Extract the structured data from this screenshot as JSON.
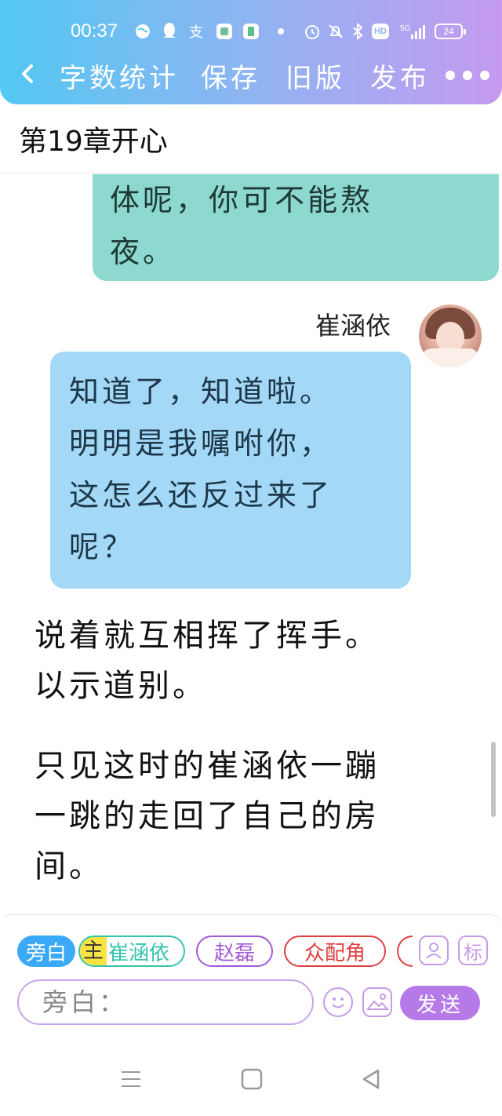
{
  "status_bar": {
    "time": "00:37",
    "battery": "24",
    "icons": [
      "browser-icon",
      "qq-icon",
      "alipay-icon",
      "app-square-icon",
      "app-book-icon",
      "dot-icon",
      "alarm-icon",
      "mute-icon",
      "bluetooth-icon",
      "hd-icon",
      "signal-5g-icon",
      "battery-icon"
    ],
    "hd": "HD",
    "net": "5G"
  },
  "toolbar": {
    "word_count": "字数统计",
    "save": "保存",
    "old_version": "旧版",
    "publish": "发布"
  },
  "chapter": {
    "title": "第19章开心"
  },
  "messages": {
    "green_text": "体呢，你可不能熬\n夜。",
    "speaker_name": "崔涵依",
    "blue_text": "知道了，知道啦。\n明明是我嘱咐你，\n这怎么还反过来了\n呢？"
  },
  "narration": {
    "p1": "说着就互相挥了挥手。\n以示道别。",
    "p2": "只见这时的崔涵依一蹦\n一跳的走回了自己的房\n间。"
  },
  "roles": {
    "narrator": "旁白",
    "main_tag": "主",
    "main_name": "崔涵依",
    "zhao": "赵磊",
    "supporting": "众配角",
    "mark": "标"
  },
  "input": {
    "placeholder": "旁白："
  },
  "send_label": "发送",
  "colors": {
    "header_start": "#52c8f2",
    "header_end": "#c59af0",
    "green_bubble": "#8dd9cf",
    "blue_bubble": "#a3d8f7",
    "send": "#b67ae8"
  }
}
